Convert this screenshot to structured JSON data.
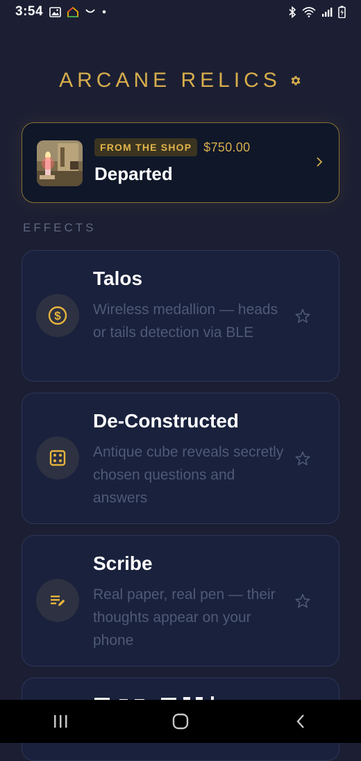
{
  "status_bar": {
    "time": "3:54",
    "icons": [
      "gallery-icon",
      "google-home-icon",
      "smile-icon",
      "dot-icon",
      "bluetooth-icon",
      "wifi-icon",
      "signal-icon",
      "battery-icon"
    ]
  },
  "header": {
    "title": "ARCANE RELICS",
    "settings_icon": "gear-icon"
  },
  "featured": {
    "badge": "FROM THE SHOP",
    "price": "$750.00",
    "title": "Departed",
    "thumbnail": "candle-photo",
    "chevron_icon": "chevron-right-icon"
  },
  "effects_section": {
    "label": "EFFECTS",
    "items": [
      {
        "title": "Talos",
        "description": "Wireless medallion — heads or tails detection via BLE",
        "icon": "coin-dollar-icon",
        "favorite_icon": "star-outline-icon"
      },
      {
        "title": "De-Constructed",
        "description": "Antique cube reveals secretly chosen questions and answers",
        "icon": "dice-icon",
        "favorite_icon": "star-outline-icon"
      },
      {
        "title": "Scribe",
        "description": "Real paper, real pen — their thoughts appear on your phone",
        "icon": "note-pen-icon",
        "favorite_icon": "star-outline-icon"
      }
    ]
  },
  "colors": {
    "background": "#1c1f33",
    "accent_gold": "#d7ad4c",
    "card": "#19213c",
    "muted_text": "#4f5a78"
  },
  "nav_bar": {
    "buttons": [
      "recents-icon",
      "home-icon",
      "back-icon"
    ]
  }
}
